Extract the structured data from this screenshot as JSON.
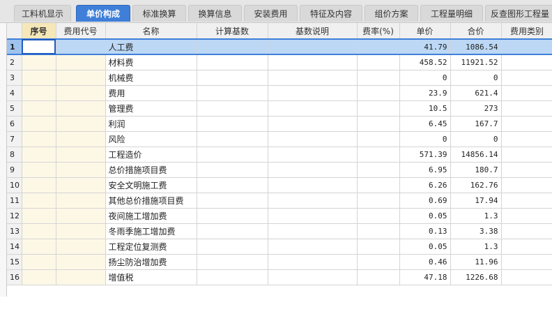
{
  "tabs": [
    {
      "label": "工料机显示",
      "active": false
    },
    {
      "label": "单价构成",
      "active": true
    },
    {
      "label": "标准换算",
      "active": false
    },
    {
      "label": "换算信息",
      "active": false
    },
    {
      "label": "安装费用",
      "active": false
    },
    {
      "label": "特征及内容",
      "active": false
    },
    {
      "label": "组价方案",
      "active": false
    },
    {
      "label": "工程量明细",
      "active": false
    },
    {
      "label": "反查图形工程量",
      "active": false
    }
  ],
  "columns": [
    "",
    "序号",
    "费用代号",
    "名称",
    "计算基数",
    "基数说明",
    "费率(%)",
    "单价",
    "合价",
    "费用类别"
  ],
  "rows": [
    {
      "n": "1",
      "name": "人工费",
      "price": "41.79",
      "total": "1086.54"
    },
    {
      "n": "2",
      "name": "材料费",
      "price": "458.52",
      "total": "11921.52"
    },
    {
      "n": "3",
      "name": "机械费",
      "price": "0",
      "total": "0"
    },
    {
      "n": "4",
      "name": "费用",
      "price": "23.9",
      "total": "621.4"
    },
    {
      "n": "5",
      "name": "管理费",
      "price": "10.5",
      "total": "273"
    },
    {
      "n": "6",
      "name": "利润",
      "price": "6.45",
      "total": "167.7"
    },
    {
      "n": "7",
      "name": "风险",
      "price": "0",
      "total": "0"
    },
    {
      "n": "8",
      "name": "工程造价",
      "price": "571.39",
      "total": "14856.14"
    },
    {
      "n": "9",
      "name": "总价措施项目费",
      "price": "6.95",
      "total": "180.7"
    },
    {
      "n": "10",
      "name": "安全文明施工费",
      "price": "6.26",
      "total": "162.76"
    },
    {
      "n": "11",
      "name": "其他总价措施项目费",
      "price": "0.69",
      "total": "17.94"
    },
    {
      "n": "12",
      "name": "夜间施工增加费",
      "price": "0.05",
      "total": "1.3"
    },
    {
      "n": "13",
      "name": "冬雨季施工增加费",
      "price": "0.13",
      "total": "3.38"
    },
    {
      "n": "14",
      "name": "工程定位复测费",
      "price": "0.05",
      "total": "1.3"
    },
    {
      "n": "15",
      "name": "扬尘防治增加费",
      "price": "0.46",
      "total": "11.96"
    },
    {
      "n": "16",
      "name": "增值税",
      "price": "47.18",
      "total": "1226.68"
    }
  ],
  "selected_row": 1
}
